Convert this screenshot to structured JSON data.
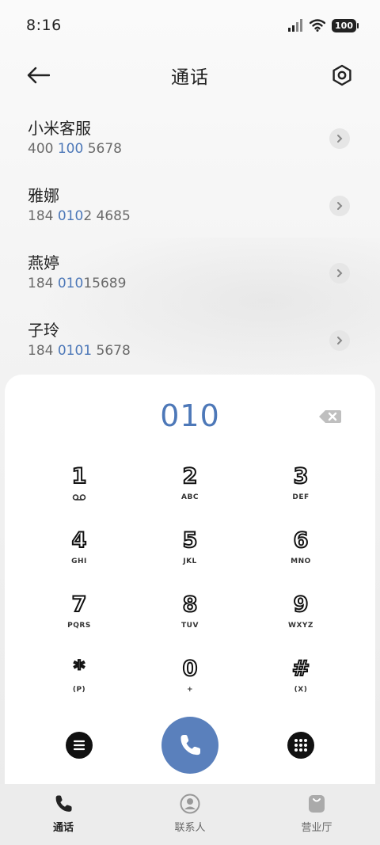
{
  "status": {
    "time": "8:16",
    "battery": "100"
  },
  "header": {
    "title": "通话"
  },
  "contacts": [
    {
      "name": "小米客服",
      "num_pre": "400 ",
      "num_hl": "100",
      "num_post": " 5678"
    },
    {
      "name": "雅娜",
      "num_pre": "184 ",
      "num_hl": "010",
      "num_post": "2 4685"
    },
    {
      "name": "燕婷",
      "num_pre": "184 ",
      "num_hl": "010",
      "num_post": "15689"
    },
    {
      "name": "子玲",
      "num_pre": "184 ",
      "num_hl": "0101",
      "num_post": " 5678"
    }
  ],
  "dialpad": {
    "display": "010",
    "keys": [
      {
        "digit": "1",
        "letters": ""
      },
      {
        "digit": "2",
        "letters": "ABC"
      },
      {
        "digit": "3",
        "letters": "DEF"
      },
      {
        "digit": "4",
        "letters": "GHI"
      },
      {
        "digit": "5",
        "letters": "JKL"
      },
      {
        "digit": "6",
        "letters": "MNO"
      },
      {
        "digit": "7",
        "letters": "PQRS"
      },
      {
        "digit": "8",
        "letters": "TUV"
      },
      {
        "digit": "9",
        "letters": "WXYZ"
      },
      {
        "digit": "*",
        "letters": "(P)"
      },
      {
        "digit": "0",
        "letters": "+"
      },
      {
        "digit": "#",
        "letters": "(X)"
      }
    ]
  },
  "tabs": [
    {
      "label": "通话",
      "icon": "phone-icon",
      "active": true
    },
    {
      "label": "联系人",
      "icon": "person-icon",
      "active": false
    },
    {
      "label": "营业厅",
      "icon": "bag-icon",
      "active": false
    }
  ],
  "colors": {
    "accent": "#4d78b8",
    "call_button": "#5a80bc"
  }
}
